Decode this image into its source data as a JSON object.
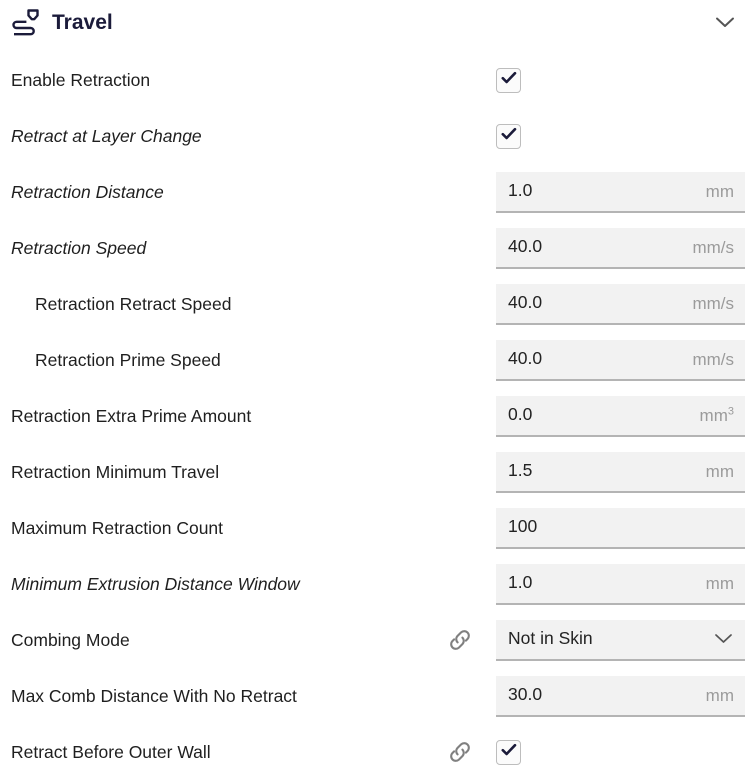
{
  "header": {
    "title": "Travel",
    "icon": "travel-nozzle-icon",
    "collapse_icon": "chevron-down-icon"
  },
  "colors": {
    "title": "#1b1b3a",
    "label": "#1f1f1f",
    "field_bg": "#f2f2f2",
    "field_underline": "#b4b4b4",
    "unit": "#9b9b9b",
    "checkmark": "#1b1b3a",
    "link_icon": "#808080"
  },
  "settings": [
    {
      "label": "Enable Retraction",
      "italic": false,
      "indent": false,
      "control": "checkbox",
      "checked": true,
      "linked": false,
      "value": "",
      "unit": ""
    },
    {
      "label": "Retract at Layer Change",
      "italic": true,
      "indent": false,
      "control": "checkbox",
      "checked": true,
      "linked": false,
      "value": "",
      "unit": ""
    },
    {
      "label": "Retraction Distance",
      "italic": true,
      "indent": false,
      "control": "field",
      "checked": false,
      "linked": false,
      "value": "1.0",
      "unit": "mm"
    },
    {
      "label": "Retraction Speed",
      "italic": true,
      "indent": false,
      "control": "field",
      "checked": false,
      "linked": false,
      "value": "40.0",
      "unit": "mm/s"
    },
    {
      "label": "Retraction Retract Speed",
      "italic": false,
      "indent": true,
      "control": "field",
      "checked": false,
      "linked": false,
      "value": "40.0",
      "unit": "mm/s"
    },
    {
      "label": "Retraction Prime Speed",
      "italic": false,
      "indent": true,
      "control": "field",
      "checked": false,
      "linked": false,
      "value": "40.0",
      "unit": "mm/s"
    },
    {
      "label": "Retraction Extra Prime Amount",
      "italic": false,
      "indent": false,
      "control": "field",
      "checked": false,
      "linked": false,
      "value": "0.0",
      "unit": "mm3"
    },
    {
      "label": "Retraction Minimum Travel",
      "italic": false,
      "indent": false,
      "control": "field",
      "checked": false,
      "linked": false,
      "value": "1.5",
      "unit": "mm"
    },
    {
      "label": "Maximum Retraction Count",
      "italic": false,
      "indent": false,
      "control": "field",
      "checked": false,
      "linked": false,
      "value": "100",
      "unit": ""
    },
    {
      "label": "Minimum Extrusion Distance Window",
      "italic": true,
      "indent": false,
      "control": "field",
      "checked": false,
      "linked": false,
      "value": "1.0",
      "unit": "mm"
    },
    {
      "label": "Combing Mode",
      "italic": false,
      "indent": false,
      "control": "dropdown",
      "checked": false,
      "linked": true,
      "value": "Not in Skin",
      "unit": ""
    },
    {
      "label": "Max Comb Distance With No Retract",
      "italic": false,
      "indent": false,
      "control": "field",
      "checked": false,
      "linked": false,
      "value": "30.0",
      "unit": "mm"
    },
    {
      "label": "Retract Before Outer Wall",
      "italic": false,
      "indent": false,
      "control": "checkbox",
      "checked": true,
      "linked": true,
      "value": "",
      "unit": ""
    }
  ]
}
